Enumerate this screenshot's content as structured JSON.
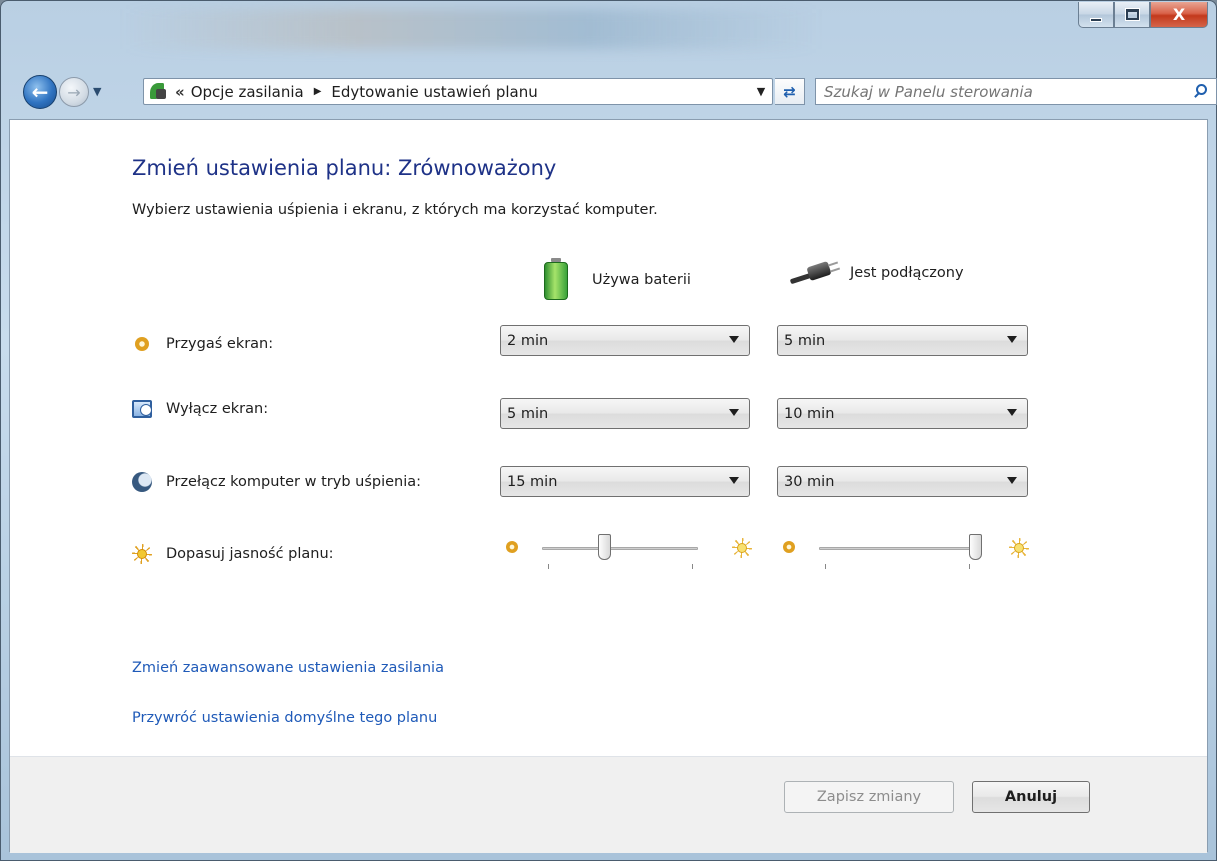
{
  "window": {
    "minimize_glyph": "minimize-icon",
    "maximize_glyph": "maximize-icon",
    "close_label": "X"
  },
  "nav": {
    "address_overflow": "«",
    "breadcrumbs": [
      "Opcje zasilania",
      "Edytowanie ustawień planu"
    ],
    "search_placeholder": "Szukaj w Panelu sterowania"
  },
  "page": {
    "title": "Zmień ustawienia planu: Zrównoważony",
    "subtitle": "Wybierz ustawienia uśpienia i ekranu, z których ma korzystać komputer.",
    "columns": {
      "battery": "Używa baterii",
      "plugged": "Jest podłączony"
    },
    "settings": [
      {
        "label": "Przygaś ekran:",
        "icon": "dim-icon",
        "battery": "2 min",
        "plugged": "5 min"
      },
      {
        "label": "Wyłącz ekran:",
        "icon": "monitor-clock-icon",
        "battery": "5 min",
        "plugged": "10 min"
      },
      {
        "label": "Przełącz komputer w tryb uśpienia:",
        "icon": "moon-sleep-icon",
        "battery": "15 min",
        "plugged": "30 min"
      }
    ],
    "brightness": {
      "label": "Dopasuj jasność planu:",
      "battery_level": 0.4,
      "plugged_level": 1.0
    },
    "links": {
      "advanced": "Zmień zaawansowane ustawienia zasilania",
      "restore": "Przywróć ustawienia domyślne tego planu"
    }
  },
  "footer": {
    "save_label": "Zapisz zmiany",
    "cancel_label": "Anuluj"
  },
  "colors": {
    "title": "#1e3287",
    "link": "#1f5ab8",
    "accent": "#2f73c1"
  }
}
